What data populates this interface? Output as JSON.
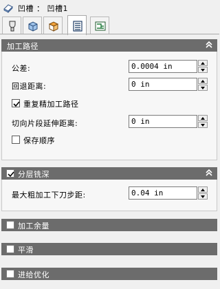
{
  "title_bar": {
    "text": "凹槽 ： 凹槽1",
    "icon": "feature-icon"
  },
  "tabs": [
    {
      "name": "tool-tab",
      "icon": "tool-icon"
    },
    {
      "name": "stock-tab",
      "icon": "cube-icon"
    },
    {
      "name": "geometry-tab",
      "icon": "box-icon"
    },
    {
      "name": "parameters-tab",
      "icon": "list-icon",
      "active": true
    },
    {
      "name": "linking-tab",
      "icon": "linking-icon"
    }
  ],
  "toolpath_section": {
    "title": "加工路径",
    "collapse_icon": "double-chevron-up-icon",
    "tolerance": {
      "label": "公差:",
      "value": "0.0004 in"
    },
    "retract_distance": {
      "label": "回退距离:",
      "value": "0 in"
    },
    "repeat_finish": {
      "label": "重复精加工路径",
      "checked": true
    },
    "tangent_extension": {
      "label": "切向片段延伸距离:",
      "value": "0 in"
    },
    "preserve_order": {
      "label": "保存顺序",
      "checked": false
    }
  },
  "step_down_section": {
    "title": "分层铣深",
    "checked": true,
    "collapse_icon": "double-chevron-up-icon",
    "max_rough_step": {
      "label": "最大粗加工下刀步距:",
      "value": "0.04 in"
    }
  },
  "stock_allowance_section": {
    "title": "加工余量",
    "checked": false
  },
  "smoothing_section": {
    "title": "平滑",
    "checked": false
  },
  "feed_optimization_section": {
    "title": "进给优化",
    "checked": false
  },
  "colors": {
    "header_bg": "#6c6c6c",
    "panel_bg": "#f7f7f7"
  }
}
